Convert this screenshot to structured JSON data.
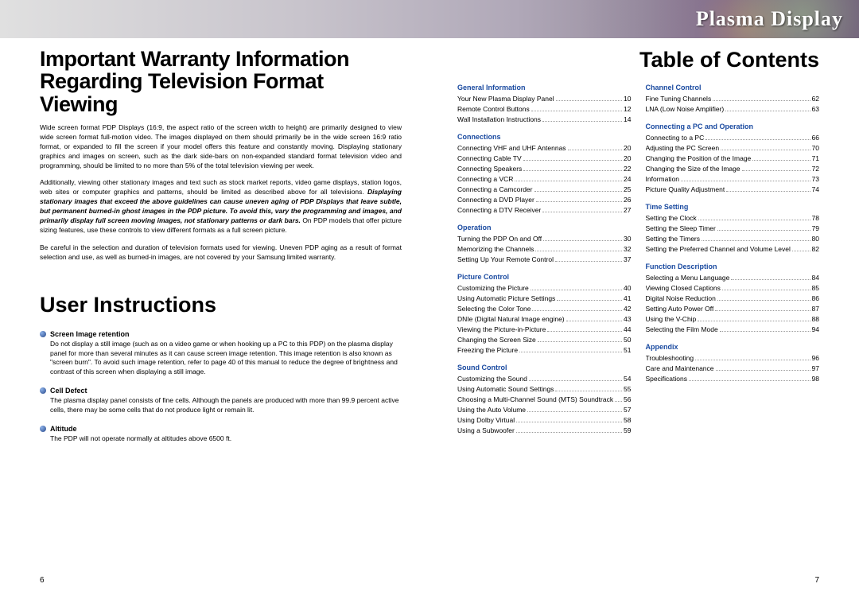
{
  "header": {
    "brand": "Plasma Display"
  },
  "left": {
    "title_line1": "Important Warranty Information",
    "title_line2": "Regarding Television Format Viewing",
    "para1": "Wide screen format PDP Displays (16:9, the aspect ratio of the screen width to height) are primarily designed to view wide screen format full-motion video. The images displayed on them should primarily be in the wide screen 16:9 ratio format, or expanded to fill the screen if your model offers this feature and constantly moving. Displaying stationary graphics and images on screen, such as the dark side-bars on non-expanded standard format television video and programming, should be limited to no more than 5% of the total television viewing per week.",
    "para2a": "Additionally, viewing other stationary images and text such as stock market reports, video game displays, station logos, web sites or computer graphics and patterns, should be limited as described above for all televisions. ",
    "para2b": "Displaying stationary images that exceed the above guidelines can cause uneven aging of PDP Displays that leave subtle, but permanent burned-in ghost images in the PDP picture. To avoid this, vary the programming and images, and primarily display full screen moving images, not stationary patterns or dark bars.",
    "para2c": " On PDP models that offer picture sizing features, use these controls to view different formats as a full screen picture.",
    "para3": "Be careful in the selection and duration of television formats used for viewing. Uneven PDP aging as a result of format selection and use, as well as burned-in images, are not covered by your Samsung limited warranty.",
    "user_heading": "User Instructions",
    "bullets": [
      {
        "title": "Screen Image retention",
        "body": "Do not display a still image (such as on a video game or when hooking up a PC to this PDP) on the plasma display panel for more than several minutes as it can cause screen image retention. This image retention is also known as \"screen burn\". To avoid such image retention, refer to page 40 of this manual to reduce the degree of brightness and contrast of this screen when displaying a still image."
      },
      {
        "title": "Cell Defect",
        "body": "The plasma display panel consists of fine cells. Although the panels are produced with more than 99.9 percent active cells, there may be some cells that do not produce light or remain lit."
      },
      {
        "title": "Altitude",
        "body": "The PDP will not operate normally at altitudes above 6500 ft."
      }
    ],
    "page_number": "6"
  },
  "right": {
    "toc_title": "Table of Contents",
    "page_number": "7",
    "col1": [
      {
        "heading": "General Information",
        "items": [
          {
            "label": "Your New Plasma Display Panel",
            "page": "10"
          },
          {
            "label": "Remote Control Buttons",
            "page": "12"
          },
          {
            "label": "Wall Installation Instructions",
            "page": "14"
          }
        ]
      },
      {
        "heading": "Connections",
        "items": [
          {
            "label": "Connecting VHF and UHF Antennas",
            "page": "20"
          },
          {
            "label": "Connecting Cable TV",
            "page": "20"
          },
          {
            "label": "Connecting Speakers",
            "page": "22"
          },
          {
            "label": "Connecting a VCR",
            "page": "24"
          },
          {
            "label": "Connecting a Camcorder",
            "page": "25"
          },
          {
            "label": "Connecting a DVD Player",
            "page": "26"
          },
          {
            "label": "Connecting a DTV Receiver",
            "page": "27"
          }
        ]
      },
      {
        "heading": "Operation",
        "items": [
          {
            "label": "Turning the PDP On and Off",
            "page": "30"
          },
          {
            "label": "Memorizing the Channels",
            "page": "32"
          },
          {
            "label": "Setting Up Your Remote Control",
            "page": "37"
          }
        ]
      },
      {
        "heading": "Picture Control",
        "items": [
          {
            "label": "Customizing the Picture",
            "page": "40"
          },
          {
            "label": "Using Automatic Picture Settings",
            "page": "41"
          },
          {
            "label": "Selecting the Color Tone",
            "page": "42"
          },
          {
            "label": "DNIe (Digital Natural Image engine)",
            "page": "43"
          },
          {
            "label": "Viewing the Picture-in-Picture",
            "page": "44"
          },
          {
            "label": "Changing the Screen Size",
            "page": "50"
          },
          {
            "label": "Freezing the Picture",
            "page": "51"
          }
        ]
      },
      {
        "heading": "Sound Control",
        "items": [
          {
            "label": "Customizing the Sound",
            "page": "54"
          },
          {
            "label": "Using Automatic Sound Settings",
            "page": "55"
          },
          {
            "label": "Choosing a Multi-Channel Sound (MTS) Soundtrack",
            "page": "56"
          },
          {
            "label": "Using the Auto Volume",
            "page": "57"
          },
          {
            "label": "Using Dolby Virtual",
            "page": "58"
          },
          {
            "label": "Using a Subwoofer",
            "page": "59"
          }
        ]
      }
    ],
    "col2": [
      {
        "heading": "Channel Control",
        "items": [
          {
            "label": "Fine Tuning Channels",
            "page": "62"
          },
          {
            "label": "LNA (Low Noise Amplifier)",
            "page": "63"
          }
        ]
      },
      {
        "heading": "Connecting a PC and Operation",
        "items": [
          {
            "label": "Connecting to a PC",
            "page": "66"
          },
          {
            "label": "Adjusting the PC Screen",
            "page": "70"
          },
          {
            "label": "Changing the Position of the Image",
            "page": "71"
          },
          {
            "label": "Changing the Size of the Image",
            "page": "72"
          },
          {
            "label": "Information",
            "page": "73"
          },
          {
            "label": "Picture Quality Adjustment",
            "page": "74"
          }
        ]
      },
      {
        "heading": "Time Setting",
        "items": [
          {
            "label": "Setting the Clock",
            "page": "78"
          },
          {
            "label": "Setting the Sleep Timer",
            "page": "79"
          },
          {
            "label": "Setting the Timers",
            "page": "80"
          },
          {
            "label": "Setting the Preferred Channel and Volume Level",
            "page": "82"
          }
        ]
      },
      {
        "heading": "Function Description",
        "items": [
          {
            "label": "Selecting a Menu Language",
            "page": "84"
          },
          {
            "label": "Viewing Closed Captions",
            "page": "85"
          },
          {
            "label": "Digital Noise Reduction",
            "page": "86"
          },
          {
            "label": "Setting Auto Power Off",
            "page": "87"
          },
          {
            "label": "Using the V-Chip",
            "page": "88"
          },
          {
            "label": "Selecting the Film Mode",
            "page": "94"
          }
        ]
      },
      {
        "heading": "Appendix",
        "items": [
          {
            "label": "Troubleshooting",
            "page": "96"
          },
          {
            "label": "Care and Maintenance",
            "page": "97"
          },
          {
            "label": "Specifications",
            "page": "98"
          }
        ]
      }
    ]
  }
}
